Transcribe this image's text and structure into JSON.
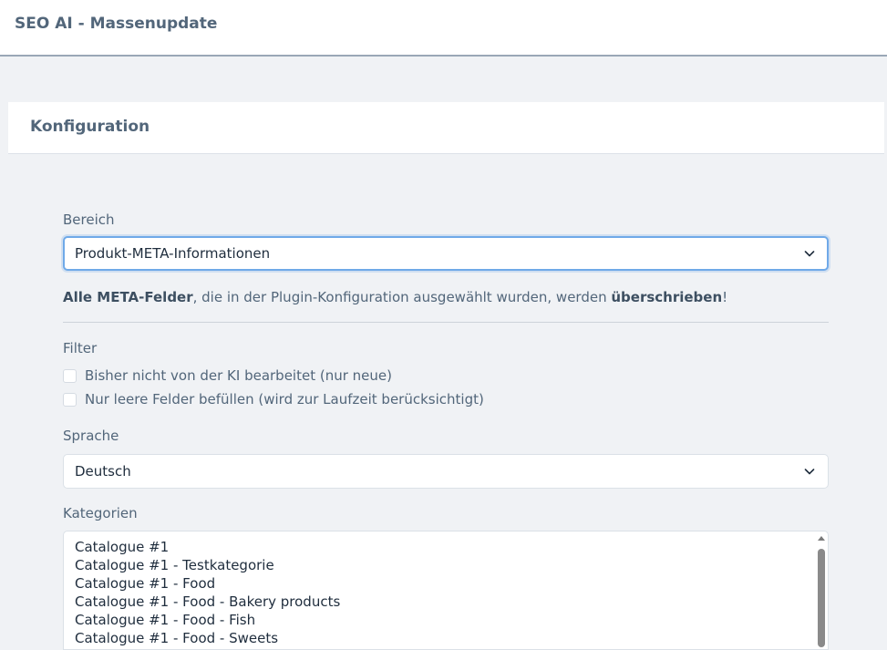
{
  "header": {
    "title": "SEO AI - Massenupdate"
  },
  "card": {
    "title": "Konfiguration"
  },
  "bereich": {
    "label": "Bereich",
    "selected": "Produkt-META-Informationen"
  },
  "notice": {
    "bold_start": "Alle META-Felder",
    "middle": ", die in der Plugin-Konfiguration ausgewählt wurden, werden ",
    "bold_end": "überschrieben",
    "end": "!"
  },
  "filter": {
    "label": "Filter",
    "options": [
      {
        "label": "Bisher nicht von der KI bearbeitet (nur neue)",
        "checked": false
      },
      {
        "label": "Nur leere Felder befüllen (wird zur Laufzeit berücksichtigt)",
        "checked": false
      }
    ]
  },
  "sprache": {
    "label": "Sprache",
    "selected": "Deutsch"
  },
  "kategorien": {
    "label": "Kategorien",
    "items": [
      "Catalogue #1",
      "Catalogue #1 - Testkategorie",
      "Catalogue #1 - Food",
      "Catalogue #1 - Food - Bakery products",
      "Catalogue #1 - Food - Fish",
      "Catalogue #1 - Food - Sweets"
    ]
  },
  "icons": {
    "select_arrow": "chevron-down-icon",
    "scroll_up": "scroll-up-arrow-icon"
  },
  "colors": {
    "focus_border": "#6fa9e8",
    "label_text": "#52667a",
    "page_background": "#f0f2f5"
  }
}
